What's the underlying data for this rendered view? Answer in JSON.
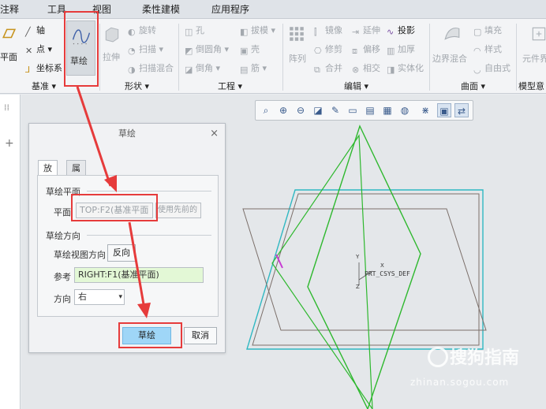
{
  "tabs": [
    "注释",
    "工具",
    "视图",
    "柔性建模",
    "应用程序"
  ],
  "ribbon": {
    "datum": {
      "plane_label": "平面",
      "axis_label": "轴",
      "point_label": "点",
      "csys_label": "坐标系",
      "sketch_label": "草绘",
      "group_label": "基准"
    },
    "shape": {
      "revolve_label": "旋转",
      "extrude_label": "拉伸",
      "sweep_label": "扫描",
      "swept_blend_label": "扫描混合",
      "group_label": "形状"
    },
    "engineering": {
      "hole_label": "孔",
      "draft_label": "拔模",
      "round_label": "倒圆角",
      "shell_label": "壳",
      "chamfer_label": "倒角",
      "rib_label": "筋",
      "group_label": "工程"
    },
    "editing": {
      "pattern_label": "阵列",
      "mirror_label": "镜像",
      "extend_label": "延伸",
      "project_label": "投影",
      "trim_label": "修剪",
      "offset_label": "偏移",
      "thicken_label": "加厚",
      "merge_label": "合并",
      "intersect_label": "相交",
      "solidify_label": "实体化",
      "group_label": "编辑"
    },
    "surfaces": {
      "fill_label": "填充",
      "style_label": "样式",
      "boundary_blend_label": "边界混合",
      "freestyle_label": "自由式",
      "group_label": "曲面"
    },
    "model_intent": {
      "element_label": "元件界",
      "group_label": "模型意图"
    }
  },
  "dialog": {
    "title": "草绘",
    "close_glyph": "×",
    "tabs": [
      "放置",
      "属性"
    ],
    "sketch_plane_section": "草绘平面",
    "plane_label": "平面",
    "plane_value": "TOP:F2(基准平面",
    "use_previous_label": "使用先前的",
    "orientation_section": "草绘方向",
    "view_direction_label": "草绘视图方向",
    "flip_label": "反向",
    "reference_label": "参考",
    "reference_value": "RIGHT:F1(基准平面)",
    "direction_label": "方向",
    "direction_value": "右",
    "ok_label": "草绘",
    "cancel_label": "取消"
  },
  "canvas": {
    "csys_label": "PRT_CSYS_DEF",
    "x_axis": "X",
    "y_axis": "Y",
    "z_axis": "Z"
  },
  "watermark": {
    "brand": "搜狗指南",
    "url": "zhinan.sogou.com"
  },
  "colors": {
    "highlight_red": "#e63b3b",
    "sketch_green": "#2eb82e",
    "plane_cyan": "#2fb8c2",
    "primary_button": "#9fd6f7"
  }
}
